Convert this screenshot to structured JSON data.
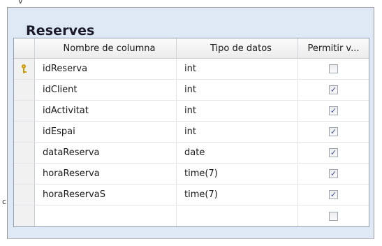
{
  "table": {
    "title": "Reserves",
    "columns": {
      "name": "Nombre de columna",
      "type": "Tipo de datos",
      "nullable": "Permitir v..."
    },
    "rows": [
      {
        "name": "idReserva",
        "type": "int",
        "nullable": false,
        "primary_key": true
      },
      {
        "name": "idClient",
        "type": "int",
        "nullable": true,
        "primary_key": false
      },
      {
        "name": "idActivitat",
        "type": "int",
        "nullable": true,
        "primary_key": false
      },
      {
        "name": "idEspai",
        "type": "int",
        "nullable": true,
        "primary_key": false
      },
      {
        "name": "dataReserva",
        "type": "date",
        "nullable": true,
        "primary_key": false
      },
      {
        "name": "horaReserva",
        "type": "time(7)",
        "nullable": true,
        "primary_key": false
      },
      {
        "name": "horaReservaS",
        "type": "time(7)",
        "nullable": true,
        "primary_key": false
      },
      {
        "name": "",
        "type": "",
        "nullable": false,
        "primary_key": false
      }
    ]
  },
  "edge_glyphs": {
    "top": "v",
    "left": "c"
  },
  "icons": {
    "primary_key": "key-icon",
    "checked": "checkmark-icon"
  },
  "colors": {
    "panel": "#dfe9f5",
    "check": "#3a4f8c",
    "key": "#f4d54d"
  }
}
